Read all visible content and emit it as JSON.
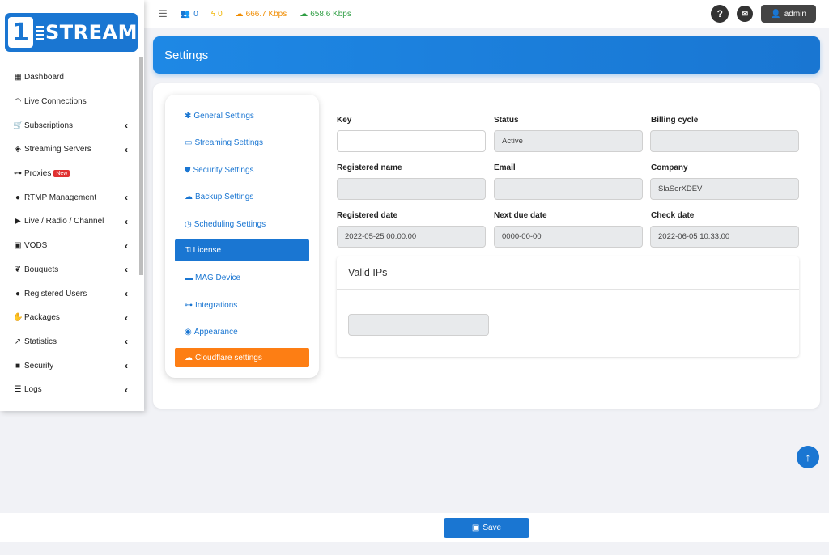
{
  "brand": {
    "logo_mark": "1",
    "logo_text": "STREAM"
  },
  "sidebar": {
    "items": [
      {
        "label": "Dashboard",
        "icon": "grid-icon",
        "glyph": "▦",
        "has_chevron": false
      },
      {
        "label": "Live Connections",
        "icon": "wifi-icon",
        "glyph": "◠",
        "has_chevron": false
      },
      {
        "label": "Subscriptions",
        "icon": "cart-icon",
        "glyph": "🛒",
        "has_chevron": true
      },
      {
        "label": "Streaming Servers",
        "icon": "layers-icon",
        "glyph": "◈",
        "has_chevron": true
      },
      {
        "label": "Proxies",
        "icon": "network-icon",
        "glyph": "⊶",
        "has_chevron": false,
        "badge": "New"
      },
      {
        "label": "RTMP Management",
        "icon": "comments-icon",
        "glyph": "●",
        "has_chevron": true
      },
      {
        "label": "Live / Radio / Channel",
        "icon": "play-icon",
        "glyph": "▶",
        "has_chevron": true
      },
      {
        "label": "VODS",
        "icon": "video-icon",
        "glyph": "▣",
        "has_chevron": true
      },
      {
        "label": "Bouquets",
        "icon": "bouquet-icon",
        "glyph": "❦",
        "has_chevron": true
      },
      {
        "label": "Registered Users",
        "icon": "user-icon",
        "glyph": "●",
        "has_chevron": true
      },
      {
        "label": "Packages",
        "icon": "handshake-icon",
        "glyph": "✋",
        "has_chevron": true
      },
      {
        "label": "Statistics",
        "icon": "chart-icon",
        "glyph": "↗",
        "has_chevron": true
      },
      {
        "label": "Security",
        "icon": "lock-icon",
        "glyph": "■",
        "has_chevron": true
      },
      {
        "label": "Logs",
        "icon": "list-icon",
        "glyph": "☰",
        "has_chevron": true
      }
    ]
  },
  "topbar": {
    "users_count": "0",
    "bolt_count": "0",
    "upload_rate": "666.7 Kbps",
    "download_rate": "658.6 Kbps",
    "help_glyph": "?",
    "admin_label": "admin"
  },
  "page": {
    "title": "Settings"
  },
  "settings_menu": {
    "items": [
      {
        "label": "General Settings",
        "icon": "gear-icon",
        "glyph": "✱"
      },
      {
        "label": "Streaming Settings",
        "icon": "monitor-icon",
        "glyph": "▭"
      },
      {
        "label": "Security Settings",
        "icon": "shield-icon",
        "glyph": "⛊"
      },
      {
        "label": "Backup Settings",
        "icon": "cloud-upload-icon",
        "glyph": "☁"
      },
      {
        "label": "Scheduling Settings",
        "icon": "clock-icon",
        "glyph": "◷"
      },
      {
        "label": "License",
        "icon": "key-icon",
        "glyph": "⚿",
        "active": true
      },
      {
        "label": "MAG Device",
        "icon": "device-icon",
        "glyph": "▬"
      },
      {
        "label": "Integrations",
        "icon": "network-icon",
        "glyph": "⊶"
      },
      {
        "label": "Appearance",
        "icon": "palette-icon",
        "glyph": "◉"
      },
      {
        "label": "Cloudflare settings",
        "icon": "cloud-icon",
        "glyph": "☁",
        "orange": true
      }
    ]
  },
  "license_form": {
    "key_label": "Key",
    "key_value": "",
    "status_label": "Status",
    "status_value": "Active",
    "billing_label": "Billing cycle",
    "billing_value": "",
    "reg_name_label": "Registered name",
    "reg_name_value": "",
    "email_label": "Email",
    "email_value": "",
    "company_label": "Company",
    "company_value": "SlaSerXDEV",
    "reg_date_label": "Registered date",
    "reg_date_value": "2022-05-25 00:00:00",
    "due_date_label": "Next due date",
    "due_date_value": "0000-00-00",
    "check_date_label": "Check date",
    "check_date_value": "2022-06-05 10:33:00"
  },
  "valid_ips": {
    "title": "Valid IPs",
    "value": ""
  },
  "footer": {
    "save_label": "Save"
  },
  "colors": {
    "primary": "#1a76d2",
    "orange": "#fd7e14",
    "upload": "#f08c00",
    "download": "#2f9e44"
  }
}
